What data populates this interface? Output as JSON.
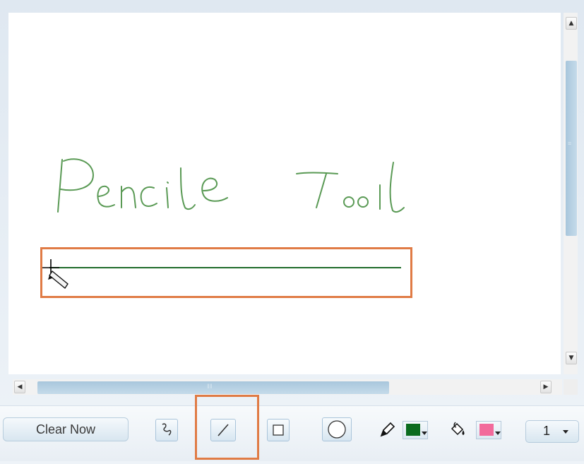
{
  "toolbar": {
    "clear_label": "Clear Now",
    "tools": [
      {
        "name": "pencil-freehand",
        "icon": "squiggle-icon"
      },
      {
        "name": "line",
        "icon": "line-icon",
        "active": true
      },
      {
        "name": "rectangle",
        "icon": "rectangle-icon"
      },
      {
        "name": "ellipse",
        "icon": "circle-icon"
      }
    ],
    "stroke_color": "#0a6b1e",
    "fill_color": "#f26a9b",
    "line_width": "1"
  },
  "canvas": {
    "handwritten_text": "Pencile Tool",
    "ink_color": "#5a9a55",
    "line_color": "#1f6b2a"
  },
  "highlight_color": "#e07b45"
}
